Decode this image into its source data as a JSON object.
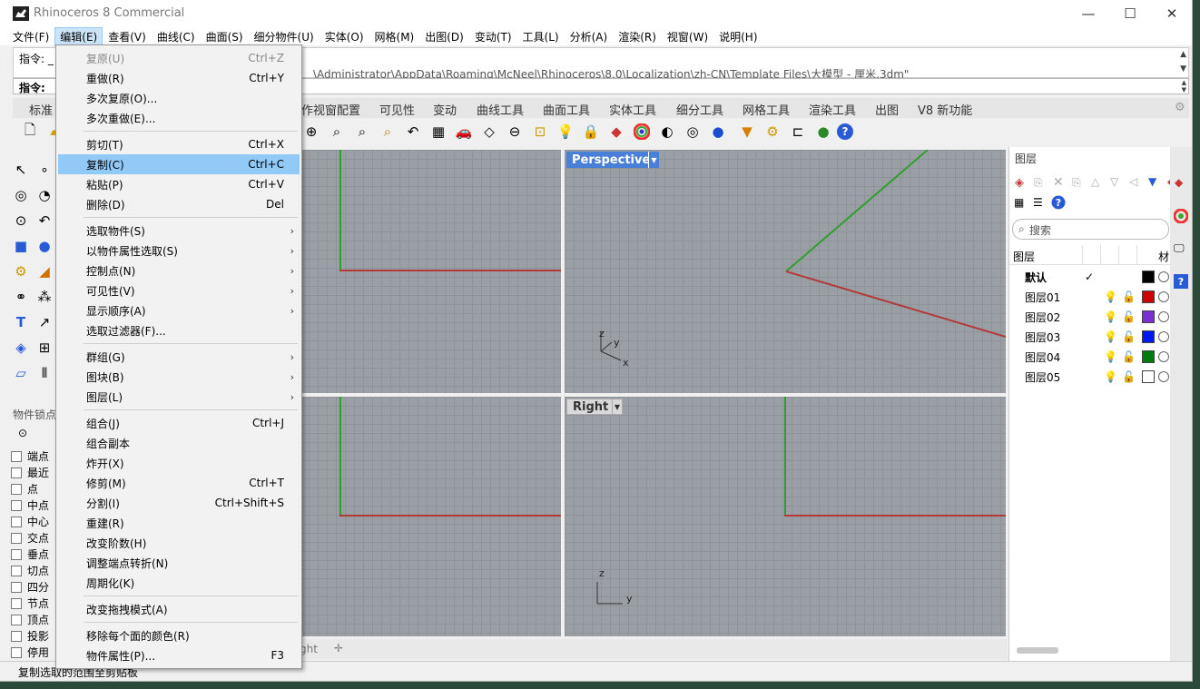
{
  "app": {
    "title": "Rhinoceros 8 Commercial"
  },
  "menubar": [
    "文件(F)",
    "编辑(E)",
    "查看(V)",
    "曲线(C)",
    "曲面(S)",
    "细分物件(U)",
    "实体(O)",
    "网格(M)",
    "出图(D)",
    "变动(T)",
    "工具(L)",
    "分析(A)",
    "渲染(R)",
    "视窗(W)",
    "说明(H)"
  ],
  "command": {
    "history_line1": "指令: _",
    "history_line2": "\\Administrator\\AppData\\Roaming\\McNeel\\Rhinoceros\\8.0\\Localization\\zh-CN\\Template Files\\大模型 - 厘米.3dm\"",
    "prompt": "指令:"
  },
  "toolbar_tabs": [
    "标准",
    "作视窗配置",
    "可见性",
    "变动",
    "曲线工具",
    "曲面工具",
    "实体工具",
    "细分工具",
    "网格工具",
    "渲染工具",
    "出图",
    "V8 新功能"
  ],
  "viewports": {
    "perspective_label": "Perspective",
    "right_label": "Right",
    "axis_x": "x",
    "axis_y": "y",
    "axis_z": "z"
  },
  "view_tabs": {
    "partial_tab": "ght"
  },
  "osnap": {
    "title": "物件锁点",
    "items": [
      "端点",
      "最近",
      "点",
      "中点",
      "中心",
      "交点",
      "垂点",
      "切点",
      "四分",
      "节点",
      "顶点",
      "投影",
      "停用"
    ]
  },
  "status": {
    "text": "复制选取的范围至剪贴板"
  },
  "layers": {
    "title": "图层",
    "search_placeholder": "搜索",
    "column_name": "图层",
    "column_material": "材",
    "rows": [
      {
        "name": "默认",
        "current": true,
        "color": "#000000"
      },
      {
        "name": "图层01",
        "current": false,
        "color": "#cc0000"
      },
      {
        "name": "图层02",
        "current": false,
        "color": "#7a2fd0"
      },
      {
        "name": "图层03",
        "current": false,
        "color": "#0018f0"
      },
      {
        "name": "图层04",
        "current": false,
        "color": "#007a10"
      },
      {
        "name": "图层05",
        "current": false,
        "color": "#ffffff"
      }
    ]
  },
  "edit_menu": {
    "undo": {
      "label": "复原(U)",
      "shortcut": "Ctrl+Z"
    },
    "redo": {
      "label": "重做(R)",
      "shortcut": "Ctrl+Y"
    },
    "multi_undo": {
      "label": "多次复原(O)..."
    },
    "multi_redo": {
      "label": "多次重做(E)..."
    },
    "cut": {
      "label": "剪切(T)",
      "shortcut": "Ctrl+X"
    },
    "copy": {
      "label": "复制(C)",
      "shortcut": "Ctrl+C"
    },
    "paste": {
      "label": "粘贴(P)",
      "shortcut": "Ctrl+V"
    },
    "delete": {
      "label": "删除(D)",
      "shortcut": "Del"
    },
    "select_objects": {
      "label": "选取物件(S)"
    },
    "select_by_props": {
      "label": "以物件属性选取(S)"
    },
    "control_points": {
      "label": "控制点(N)"
    },
    "visibility": {
      "label": "可见性(V)"
    },
    "display_order": {
      "label": "显示顺序(A)"
    },
    "select_filter": {
      "label": "选取过滤器(F)..."
    },
    "group": {
      "label": "群组(G)"
    },
    "block": {
      "label": "图块(B)"
    },
    "layer": {
      "label": "图层(L)"
    },
    "join": {
      "label": "组合(J)",
      "shortcut": "Ctrl+J"
    },
    "join_copy": {
      "label": "组合副本"
    },
    "explode": {
      "label": "炸开(X)"
    },
    "trim": {
      "label": "修剪(M)",
      "shortcut": "Ctrl+T"
    },
    "split": {
      "label": "分割(I)",
      "shortcut": "Ctrl+Shift+S"
    },
    "rebuild": {
      "label": "重建(R)"
    },
    "change_degree": {
      "label": "改变阶数(H)"
    },
    "adjust_seam": {
      "label": "调整端点转折(N)"
    },
    "periodic": {
      "label": "周期化(K)"
    },
    "drag_mode": {
      "label": "改变拖拽模式(A)"
    },
    "remove_face_colors": {
      "label": "移除每个面的颜色(R)"
    },
    "object_properties": {
      "label": "物件属性(P)...",
      "shortcut": "F3"
    }
  }
}
